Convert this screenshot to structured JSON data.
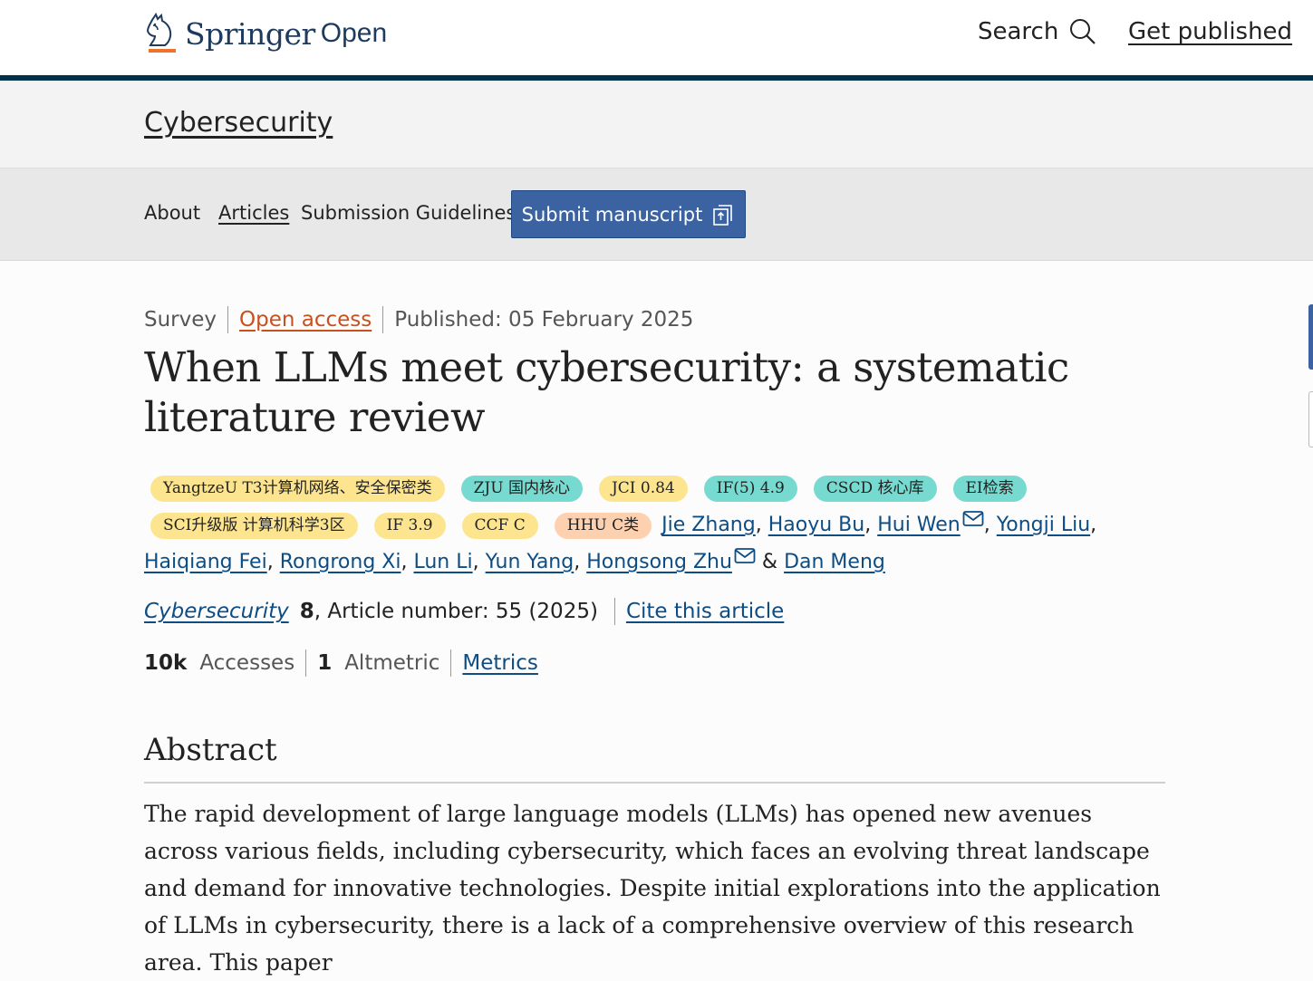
{
  "header": {
    "brand": "Springer",
    "brand_suffix": "Open",
    "search_label": "Search",
    "get_published": "Get published"
  },
  "journal": {
    "name": "Cybersecurity"
  },
  "nav": {
    "items": [
      "About",
      "Articles",
      "Submission Guidelines"
    ],
    "submit_label": "Submit manuscript"
  },
  "article": {
    "type": "Survey",
    "access": "Open access",
    "published": "Published: 05 February 2025",
    "title": "When LLMs meet cybersecurity: a systematic literature review",
    "badges": [
      {
        "text": "YangtzeU T3计算机网络、安全保密类",
        "color": "#fde58f"
      },
      {
        "text": "ZJU 国内核心",
        "color": "#76dad0"
      },
      {
        "text": "JCI 0.84",
        "color": "#fde58f"
      },
      {
        "text": "IF(5) 4.9",
        "color": "#76dad0"
      },
      {
        "text": "CSCD 核心库",
        "color": "#76dad0"
      },
      {
        "text": "EI检索",
        "color": "#76dad0"
      },
      {
        "text": "SCI升级版 计算机科学3区",
        "color": "#fde58f"
      },
      {
        "text": "IF 3.9",
        "color": "#fde58f"
      },
      {
        "text": "CCF C",
        "color": "#fde58f"
      },
      {
        "text": "HHU C类",
        "color": "#fdd0b0"
      }
    ],
    "authors": [
      "Jie Zhang",
      "Haoyu Bu",
      "Hui Wen",
      "Yongji Liu",
      "Haiqiang Fei",
      "Rongrong Xi",
      "Lun Li",
      "Yun Yang",
      "Hongsong Zhu",
      "Dan Meng"
    ],
    "author_and": "&",
    "citation": {
      "journal": "Cybersecurity",
      "volume": "8",
      "rest": ", Article number: 55 (2025)",
      "cite_label": "Cite this article"
    },
    "metrics": {
      "accesses_value": "10k",
      "accesses_label": "Accesses",
      "altmetric_value": "1",
      "altmetric_label": "Altmetric",
      "metrics_link": "Metrics"
    },
    "abstract_heading": "Abstract",
    "abstract_text": "The rapid development of large language models (LLMs) has opened new avenues across various fields, including cybersecurity, which faces an evolving threat landscape and demand for innovative technologies. Despite initial explorations into the application of LLMs in cybersecurity, there is a lack of a comprehensive overview of this research area. This paper"
  },
  "colors": {
    "brand_navy": "#01324b",
    "submit_button": "#3b62a1",
    "open_access": "#c7501d",
    "link": "#0d4d84",
    "badge_yellow": "#fde58f",
    "badge_teal": "#76dad0",
    "badge_peach": "#fdd0b0",
    "logo_orange": "#f0712c"
  },
  "icons": [
    "springer-horse-logo-icon",
    "search-icon",
    "external-submit-icon",
    "mail-icon"
  ]
}
